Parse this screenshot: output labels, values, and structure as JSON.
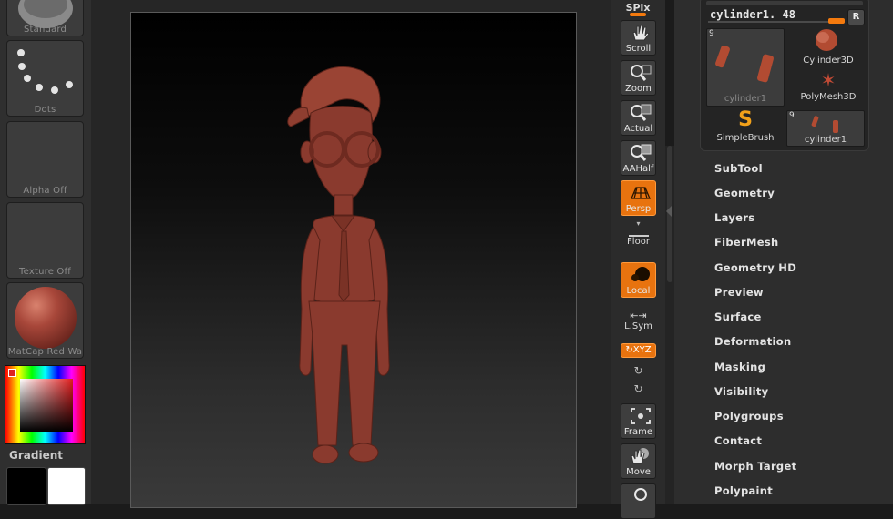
{
  "left_shelf": {
    "brush_label": "Standard",
    "stroke_label": "Dots",
    "alpha_label": "Alpha  Off",
    "texture_label": "Texture  Off",
    "material_label": "MatCap  Red  Wa",
    "gradient_label": "Gradient"
  },
  "toolbar": {
    "spix_label": "SPix",
    "buttons": [
      {
        "label": "Scroll",
        "icon": "hand-icon",
        "active": false
      },
      {
        "label": "Zoom",
        "icon": "magnifier-icon",
        "active": false
      },
      {
        "label": "Actual",
        "icon": "magnifier-actual-icon",
        "active": false
      },
      {
        "label": "AAHalf",
        "icon": "magnifier-aahalf-icon",
        "active": false
      },
      {
        "label": "Persp",
        "icon": "perspective-grid-icon",
        "active": true
      },
      {
        "label": "Floor",
        "icon": "floor-icon",
        "active": false
      },
      {
        "label": "Local",
        "icon": "local-symmetry-icon",
        "active": true
      },
      {
        "label": "L.Sym",
        "icon": "arrows-horizontal-icon",
        "active": false
      },
      {
        "label": "XYZ",
        "icon": "xyz-rotate-icon",
        "active": true
      },
      {
        "label": "Frame",
        "icon": "frame-icon",
        "active": false
      },
      {
        "label": "Move",
        "icon": "move-hand-icon",
        "active": false
      }
    ]
  },
  "tool_panel": {
    "current_tool": "cylinder1. 48",
    "r_label": "R",
    "items": [
      {
        "label": "cylinder1",
        "count": "9"
      },
      {
        "label": "Cylinder3D"
      },
      {
        "label": "PolyMesh3D"
      },
      {
        "label": "SimpleBrush"
      },
      {
        "label": "cylinder1",
        "count": "9"
      }
    ]
  },
  "menu": [
    "SubTool",
    "Geometry",
    "Layers",
    "FiberMesh",
    "Geometry HD",
    "Preview",
    "Surface",
    "Deformation",
    "Masking",
    "Visibility",
    "Polygroups",
    "Contact",
    "Morph Target",
    "Polypaint"
  ],
  "colors": {
    "accent": "#f47a0e",
    "model": "#8a3a2e",
    "panel": "#2d2d2d"
  }
}
